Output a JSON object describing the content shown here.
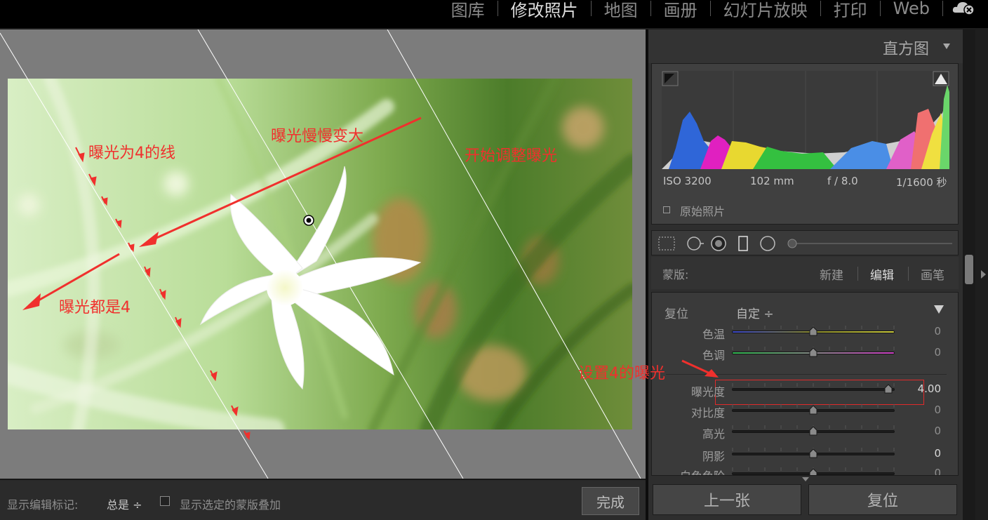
{
  "modules": [
    "图库",
    "修改照片",
    "地图",
    "画册",
    "幻灯片放映",
    "打印",
    "Web"
  ],
  "active_module": "修改照片",
  "annotations": {
    "line_label": "曝光为4的线",
    "growing_label": "曝光慢慢变大",
    "start_label": "开始调整曝光",
    "all_four_label": "曝光都是4",
    "set_label": "设置4的曝光"
  },
  "toolbar": {
    "show_marks_label": "显示编辑标记:",
    "show_marks_value": "总是 ÷",
    "overlay_label": "显示选定的蒙版叠加",
    "done_label": "完成"
  },
  "histogram": {
    "title": "直方图",
    "iso": "ISO 3200",
    "focal": "102 mm",
    "aperture": "f / 8.0",
    "shutter": "1/1600 秒",
    "original_label": "原始照片"
  },
  "mask": {
    "label": "蒙版:",
    "new_label": "新建",
    "edit_label": "编辑",
    "brush_label": "画笔"
  },
  "adjust": {
    "reset_label": "复位",
    "preset_value": "自定 ÷",
    "sliders": [
      {
        "label": "色温",
        "value": "0",
        "position": 0.5
      },
      {
        "label": "色调",
        "value": "0",
        "position": 0.5
      },
      {
        "label": "曝光度",
        "value": "4.00",
        "position": 0.96
      },
      {
        "label": "对比度",
        "value": "0",
        "position": 0.5
      },
      {
        "label": "高光",
        "value": "0",
        "position": 0.5
      },
      {
        "label": "阴影",
        "value": "0",
        "position": 0.5
      },
      {
        "label": "白色色阶",
        "value": "0",
        "position": 0.5
      }
    ]
  },
  "buttons": {
    "prev_label": "上一张",
    "reset_label": "复位"
  },
  "colors": {
    "accent_red": "#f0302d",
    "panel_bg": "#2e2e2e",
    "viewer_bg": "#7c7c7c"
  }
}
